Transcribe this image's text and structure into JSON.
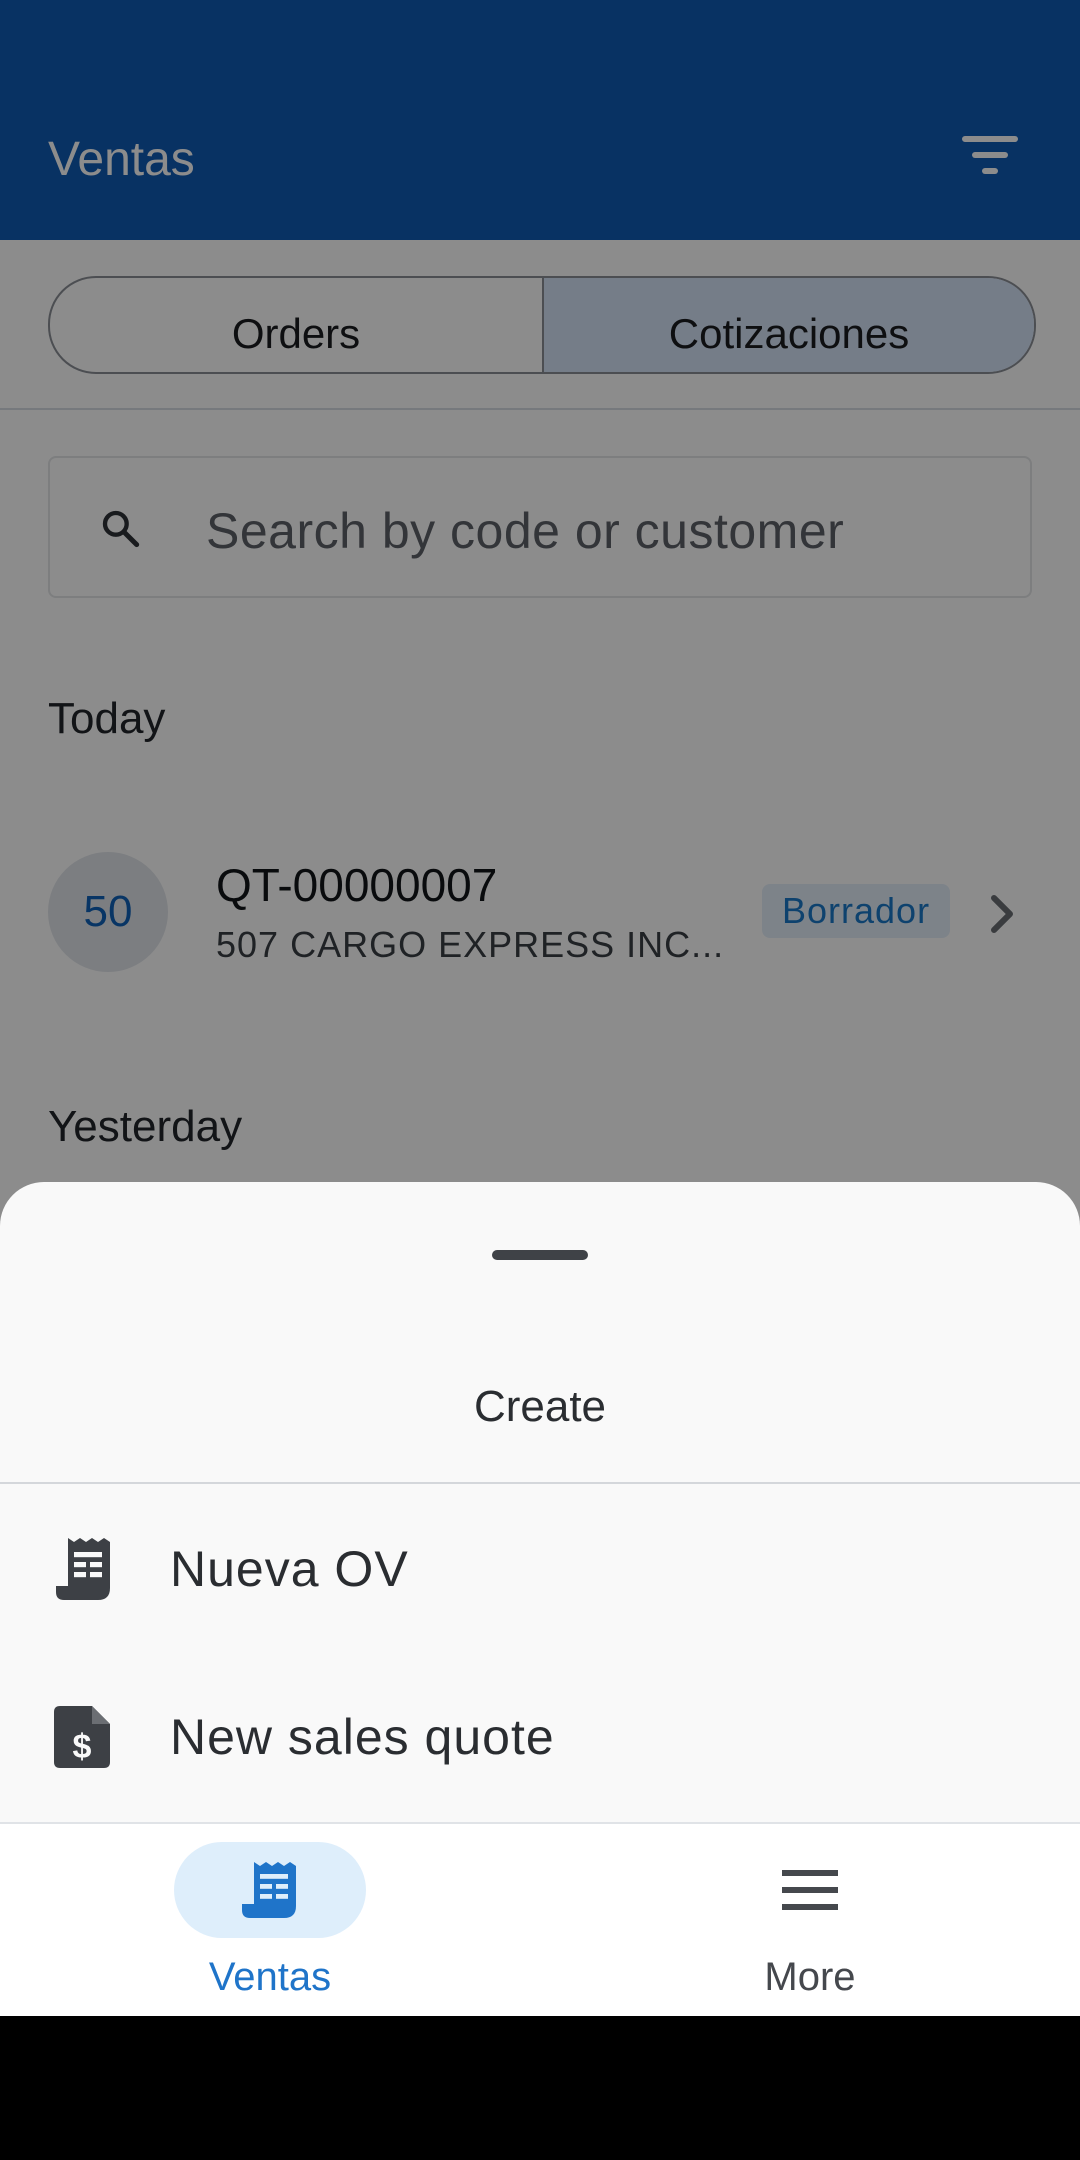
{
  "app_bar": {
    "title": "Ventas"
  },
  "segments": {
    "orders": "Orders",
    "quotes": "Cotizaciones"
  },
  "search": {
    "placeholder": "Search by code or customer"
  },
  "sections": {
    "today": "Today",
    "yesterday": "Yesterday"
  },
  "quote_row": {
    "avatar": "50",
    "code": "QT-00000007",
    "customer": "507 CARGO EXPRESS INC...",
    "status": "Borrador"
  },
  "sheet": {
    "title": "Create",
    "items": [
      {
        "label": "Nueva OV",
        "icon": "receipt-icon"
      },
      {
        "label": "New sales quote",
        "icon": "dollar-document-icon"
      }
    ]
  },
  "bottom_nav": {
    "items": [
      {
        "label": "Ventas",
        "icon": "receipt-icon",
        "active": true
      },
      {
        "label": "More",
        "icon": "menu-icon",
        "active": false
      }
    ]
  },
  "colors": {
    "primary": "#0f5bb4",
    "accent": "#1a78c8",
    "selected_segment": "#d6e3f7",
    "nav_pill": "#deeefb"
  }
}
